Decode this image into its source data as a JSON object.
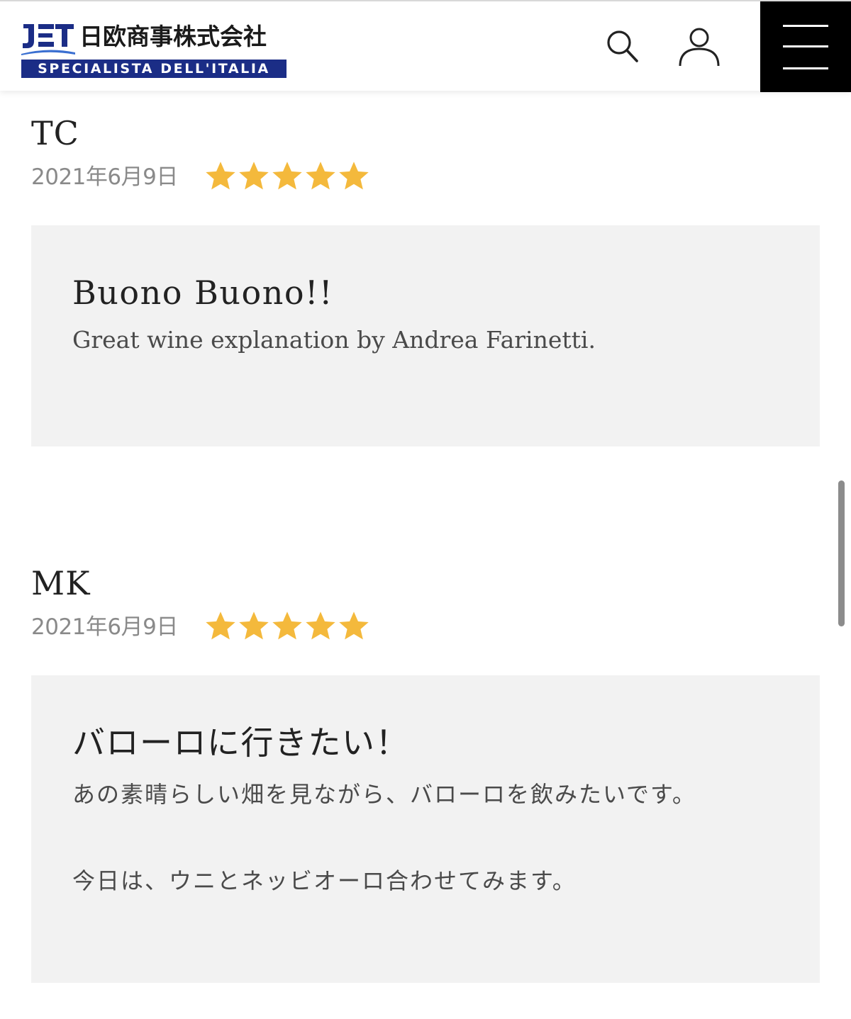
{
  "header": {
    "logo_mark": "JET",
    "company_name": "日欧商事株式会社",
    "tagline": "SPECIALISTA DELL'ITALIA",
    "brand_color": "#1b2d86",
    "icons": {
      "search": "search-icon",
      "user": "user-icon",
      "menu": "hamburger-menu-icon"
    }
  },
  "reviews": [
    {
      "reviewer": "TC",
      "date": "2021年6月9日",
      "rating": 5,
      "rating_max": 5,
      "title": "Buono Buono!!",
      "body": [
        "Great wine explanation by Andrea Farinetti."
      ]
    },
    {
      "reviewer": "MK",
      "date": "2021年6月9日",
      "rating": 5,
      "rating_max": 5,
      "title": "バローロに行きたい！",
      "body": [
        "あの素晴らしい畑を見ながら、バローロを飲みたいです。",
        "今日は、ウニとネッビオーロ合わせてみます。"
      ]
    }
  ],
  "colors": {
    "star": "#f4b93c",
    "review_box_bg": "#f2f2f2",
    "date_text": "#8a8a8a",
    "menu_bg": "#000000"
  }
}
